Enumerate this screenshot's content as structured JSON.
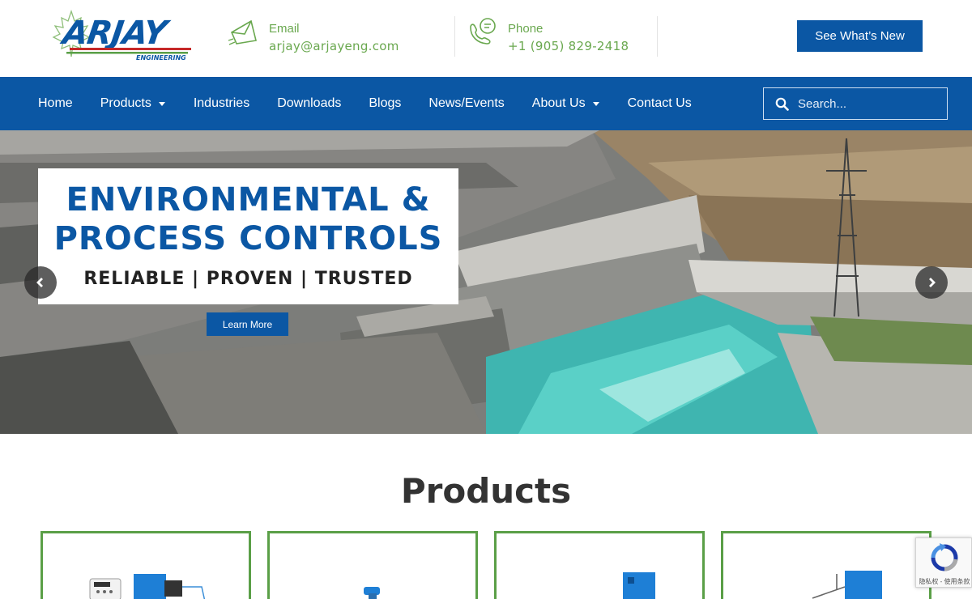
{
  "brand": {
    "logo_text": "ARJAY",
    "logo_subtext": "ENGINEERING"
  },
  "header": {
    "email": {
      "label": "Email",
      "value": "arjay@arjayeng.com",
      "icon": "envelope-icon"
    },
    "phone": {
      "label": "Phone",
      "value": "+1 (905) 829-2418",
      "icon": "phone-chat-icon"
    },
    "whats_new_label": "See What’s New"
  },
  "nav": {
    "items": [
      {
        "label": "Home",
        "has_dropdown": false
      },
      {
        "label": "Products",
        "has_dropdown": true
      },
      {
        "label": "Industries",
        "has_dropdown": false
      },
      {
        "label": "Downloads",
        "has_dropdown": false
      },
      {
        "label": "Blogs",
        "has_dropdown": false
      },
      {
        "label": "News/Events",
        "has_dropdown": false
      },
      {
        "label": "About Us",
        "has_dropdown": true
      },
      {
        "label": "Contact Us",
        "has_dropdown": false
      }
    ],
    "search_placeholder": "Search..."
  },
  "hero": {
    "headline_line1": "ENVIRONMENTAL &",
    "headline_line2": "PROCESS CONTROLS",
    "tagline": "RELIABLE | PROVEN | TRUSTED",
    "cta_label": "Learn More"
  },
  "products": {
    "title": "Products"
  },
  "recaptcha": {
    "text": "隐私权 - 使用条款"
  },
  "colors": {
    "brand_blue": "#0b57a4",
    "accent_green": "#6aa84f",
    "card_border": "#5a9f47"
  }
}
